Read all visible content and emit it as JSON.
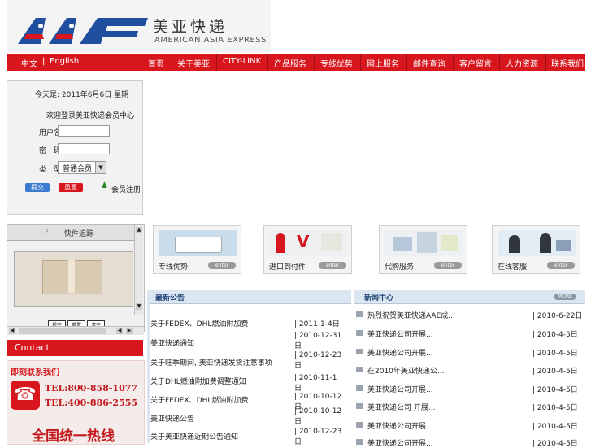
{
  "header": {
    "logo_text": "AAE",
    "brand_cn": "美亚快递",
    "brand_en": "AMERICAN ASIA EXPRESS"
  },
  "lang": {
    "zh": "中文",
    "sep": "|",
    "en": "English"
  },
  "nav": [
    "首页",
    "关于美亚",
    "CITY-LINK",
    "产品服务",
    "专线优势",
    "网上服务",
    "邮件查询",
    "客户留言",
    "人力资源",
    "联系我们"
  ],
  "login": {
    "date_text": "今天是: 2011年6月6日 星期一",
    "welcome": "欢迎登录美亚快递会员中心",
    "user_label": "用户名：",
    "pass_label": "密　码：",
    "type_label": "类　型：",
    "type_value": "普通会员",
    "submit": "提交",
    "reset": "重置",
    "register": "会员注册"
  },
  "tracking": {
    "title": "快件追踪",
    "p1": "提交",
    "p2": "重置",
    "p3": "清空"
  },
  "contact": {
    "bar": "Contact",
    "headline": "即刻联系我们",
    "tel1": "TEL:800-858-1077",
    "tel2": "TEL:400-886-2555",
    "hotline": "全国统一热线"
  },
  "banners": [
    {
      "caption": "专线优势",
      "enter": "enter"
    },
    {
      "caption": "进口到付件",
      "enter": "enter"
    },
    {
      "caption": "代购服务",
      "enter": "enter"
    },
    {
      "caption": "在线客服",
      "enter": "enter"
    }
  ],
  "announce": {
    "title": "最新公告",
    "items": [
      {
        "title": "关于FEDEX、DHL燃油附加费",
        "date": "| 2011-1-4日"
      },
      {
        "title": "美亚快递通知",
        "date": "| 2010-12-31日"
      },
      {
        "title": "关于旺季期间, 美亚快递发货注意事项",
        "date": "| 2010-12-23日"
      },
      {
        "title": "关于DHL燃油附加费调整通知",
        "date": "| 2010-11-1日"
      },
      {
        "title": "关于FEDEX、DHL燃油附加费",
        "date": "| 2010-10-12日"
      },
      {
        "title": "美亚快递公告",
        "date": "| 2010-10-12日"
      },
      {
        "title": "关于美亚快递近期公告通知",
        "date": "| 2010-12-23日"
      }
    ]
  },
  "news": {
    "title": "新闻中心",
    "more": "MORE",
    "items": [
      {
        "title": "热烈祝贺美亚快递AAE成...",
        "date": "| 2010-6-22日"
      },
      {
        "title": "美亚快递公司开展...",
        "date": "| 2010-4-5日"
      },
      {
        "title": "美亚快递公司开展...",
        "date": "| 2010-4-5日"
      },
      {
        "title": "在2010年美亚快递公...",
        "date": "| 2010-4-5日"
      },
      {
        "title": "美亚快递公司开展...",
        "date": "| 2010-4-5日"
      },
      {
        "title": "美亚快递公司 开展...",
        "date": "| 2010-4-5日"
      },
      {
        "title": "美亚快递公司开展...",
        "date": "| 2010-4-5日"
      },
      {
        "title": "美亚快递公司开展...",
        "date": "| 2010-4-5日"
      }
    ]
  }
}
